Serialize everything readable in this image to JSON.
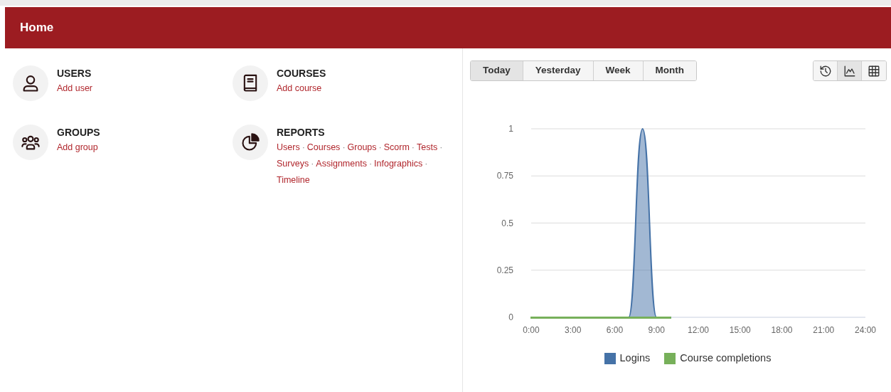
{
  "header": {
    "title": "Home"
  },
  "sections": [
    {
      "kind": "users",
      "title": "USERS",
      "links": [
        "Add user"
      ]
    },
    {
      "kind": "courses",
      "title": "COURSES",
      "links": [
        "Add course"
      ]
    },
    {
      "kind": "groups",
      "title": "GROUPS",
      "links": [
        "Add group"
      ]
    },
    {
      "kind": "reports",
      "title": "REPORTS",
      "separator": "·",
      "links": [
        "Users",
        "Courses",
        "Groups",
        "Scorm",
        "Tests",
        "Surveys",
        "Assignments",
        "Infographics",
        "Timeline"
      ]
    }
  ],
  "periods": [
    {
      "label": "Today",
      "selected": true
    },
    {
      "label": "Yesterday",
      "selected": false
    },
    {
      "label": "Week",
      "selected": false
    },
    {
      "label": "Month",
      "selected": false
    }
  ],
  "views": [
    {
      "kind": "history",
      "selected": false
    },
    {
      "kind": "chart",
      "selected": true
    },
    {
      "kind": "table",
      "selected": false
    }
  ],
  "chart": {
    "chart_data": {
      "type": "area",
      "x": [
        0,
        1,
        2,
        3,
        4,
        5,
        6,
        7,
        8,
        9,
        10
      ],
      "series": [
        {
          "name": "Logins",
          "color": "#4572a7",
          "values": [
            0,
            0,
            0,
            0,
            0,
            0,
            0,
            0,
            1,
            0,
            0
          ]
        },
        {
          "name": "Course completions",
          "color": "#77b05a",
          "values": [
            0,
            0,
            0,
            0,
            0,
            0,
            0,
            0,
            0,
            0,
            0
          ]
        }
      ],
      "xlim": [
        0,
        24
      ],
      "ylim": [
        0,
        1
      ],
      "grid": true,
      "legend": "bottom",
      "xticks": [
        {
          "value": 0,
          "label": "0:00"
        },
        {
          "value": 3,
          "label": "3:00"
        },
        {
          "value": 6,
          "label": "6:00"
        },
        {
          "value": 9,
          "label": "9:00"
        },
        {
          "value": 12,
          "label": "12:00"
        },
        {
          "value": 15,
          "label": "15:00"
        },
        {
          "value": 18,
          "label": "18:00"
        },
        {
          "value": 21,
          "label": "21:00"
        },
        {
          "value": 24,
          "label": "24:00"
        }
      ],
      "yticks": [
        {
          "value": 0,
          "label": "0"
        },
        {
          "value": 0.25,
          "label": "0.25"
        },
        {
          "value": 0.5,
          "label": "0.5"
        },
        {
          "value": 0.75,
          "label": "0.75"
        },
        {
          "value": 1,
          "label": "1"
        }
      ]
    }
  }
}
